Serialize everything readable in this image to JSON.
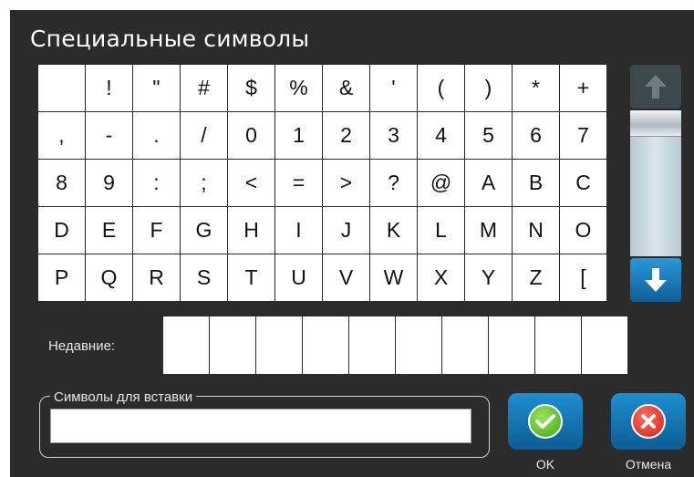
{
  "dialog": {
    "title": "Специальные символы",
    "symbols": [
      "",
      "!",
      "\"",
      "#",
      "$",
      "%",
      "&",
      "'",
      "(",
      ")",
      "*",
      "+",
      ",",
      "-",
      ".",
      "/",
      "0",
      "1",
      "2",
      "3",
      "4",
      "5",
      "6",
      "7",
      "8",
      "9",
      ":",
      ";",
      "<",
      "=",
      ">",
      "?",
      "@",
      "A",
      "B",
      "C",
      "D",
      "E",
      "F",
      "G",
      "H",
      "I",
      "J",
      "K",
      "L",
      "M",
      "N",
      "O",
      "P",
      "Q",
      "R",
      "S",
      "T",
      "U",
      "V",
      "W",
      "X",
      "Y",
      "Z",
      "["
    ],
    "scrollbar": {
      "up_icon": "arrow-up-icon",
      "down_icon": "arrow-down-icon",
      "position": 0
    },
    "recent_label": "Недавние:",
    "recent_slot_count": 10,
    "paste_label": "Символы для вставки",
    "paste_value": "",
    "ok_label": "OK",
    "cancel_label": "Отмена",
    "colors": {
      "background": "#2b2b2b",
      "button_blue": "#1b7fbf",
      "ok_green": "#4fb82a",
      "cancel_red": "#e0342a"
    }
  }
}
